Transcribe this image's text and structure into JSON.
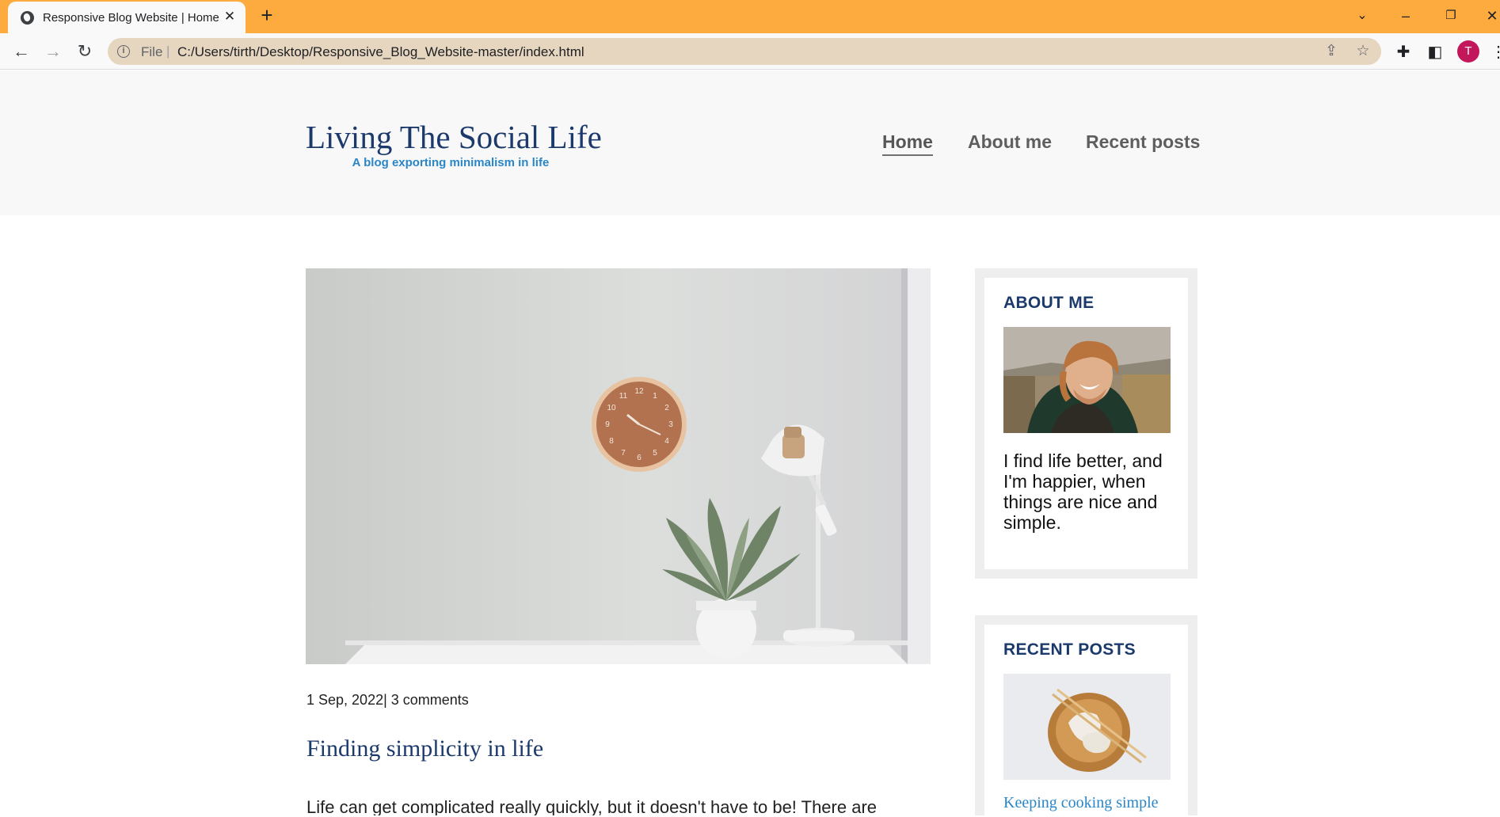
{
  "browser": {
    "tab_title": "Responsive Blog Website | Home",
    "new_tab": "+",
    "file_label": "File",
    "url": "C:/Users/tirth/Desktop/Responsive_Blog_Website-master/index.html",
    "profile_initial": "T",
    "accent_color": "#fdab3f"
  },
  "site": {
    "title": "Living The Social Life",
    "tagline": "A blog exporting minimalism in life",
    "nav": [
      "Home",
      "About me",
      "Recent posts"
    ]
  },
  "post": {
    "meta": "1 Sep, 2022| 3 comments",
    "title": "Finding simplicity in life",
    "excerpt": "Life can get complicated really quickly, but it doesn't have to be! There are"
  },
  "sidebar": {
    "about_title": "ABOUT ME",
    "about_text": "I find life better, and I'm happier, when things are nice and simple.",
    "recent_title": "RECENT POSTS",
    "recent_link": "Keeping cooking simple"
  }
}
